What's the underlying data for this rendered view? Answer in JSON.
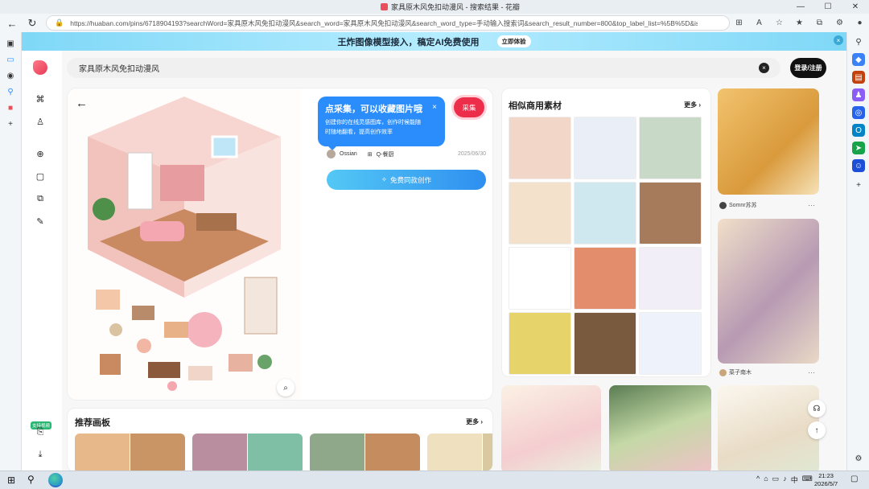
{
  "browser": {
    "tab_title": "家具原木风免扣动漫风 - 搜索结果 - 花瓣",
    "url": "https://huaban.com/pins/6718904193?searchWord=家具原木风免扣动漫风&search_word=家具原木风免扣动漫风&search_word_type=手动输入搜索词&search_result_number=800&top_label_list=%5B%5D&isNeedTrack=true",
    "window_controls": [
      "—",
      "☐",
      "✕"
    ]
  },
  "banner": {
    "text": "王炸图像模型接入，稿定AI免费使用",
    "button": "立即体验",
    "close": "×"
  },
  "search": {
    "value": "家具原木风免扣动漫风",
    "clear": "×"
  },
  "header": {
    "login": "登录/注册"
  },
  "sidebar": {
    "badge": "支持视频"
  },
  "pin": {
    "collect_button": "采集",
    "tip_title": "点采集，可以收藏图片哦",
    "tip_body": "创建你的在线灵感图库，创作时候能随时随地翻看，提高创作效率",
    "tip_close": "×",
    "author": "Ossian",
    "board": "Q-餐厨",
    "date": "2025/06/30",
    "create_button": "免费同款创作"
  },
  "similar": {
    "title": "相似商用素材",
    "more": "更多",
    "tiles": [
      "#f2d7c8",
      "#e9eef7",
      "#c9d9c8",
      "#f3e1cc",
      "#cfe7ef",
      "#a57b5c",
      "#ffffff",
      "#e48d6c",
      "#f1eef7",
      "#e6d36a",
      "#7a5a3e",
      "#eef3fb"
    ]
  },
  "right_column": {
    "user1": "Somnr苏苏",
    "user2": "菜子南木",
    "dots": "···"
  },
  "recommend": {
    "title": "推荐画板",
    "more": "更多"
  },
  "taskbar": {
    "ime": "中",
    "time": "21:23",
    "date": "2026/5/7"
  },
  "colors": {
    "brand_red": "#ec2e4a",
    "tip_blue": "#2a8dfb",
    "banner_blue": "#7fd8f7"
  }
}
